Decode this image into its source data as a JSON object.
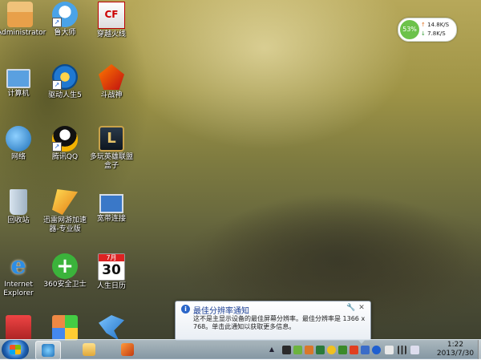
{
  "desktop": {
    "icons": [
      {
        "key": "admin",
        "label": "Administrator",
        "icon": "user-folder-icon"
      },
      {
        "key": "computer",
        "label": "计算机",
        "icon": "computer-icon"
      },
      {
        "key": "network",
        "label": "网络",
        "icon": "network-icon"
      },
      {
        "key": "recycle",
        "label": "回收站",
        "icon": "recycle-bin-icon"
      },
      {
        "key": "ie",
        "label": "Internet Explorer",
        "icon": "internet-explorer-icon"
      },
      {
        "key": "ludashi",
        "label": "鲁大师",
        "icon": "ludashi-icon"
      },
      {
        "key": "driver",
        "label": "驱动人生5",
        "icon": "driver-life-icon"
      },
      {
        "key": "qq",
        "label": "腾讯QQ",
        "icon": "qq-icon"
      },
      {
        "key": "thunder",
        "label": "迅雷网游加速器-专业版",
        "icon": "thunder-accelerator-icon"
      },
      {
        "key": "s360",
        "label": "360安全卫士",
        "icon": "360-safe-icon"
      },
      {
        "key": "cf",
        "label": "穿越火线",
        "icon": "crossfire-icon"
      },
      {
        "key": "dou",
        "label": "斗战神",
        "icon": "douzhanshen-icon"
      },
      {
        "key": "lol",
        "label": "多玩英雄联盟盒子",
        "icon": "lol-box-icon"
      },
      {
        "key": "remote",
        "label": "宽带连接",
        "icon": "broadband-connection-icon"
      },
      {
        "key": "calendar",
        "label": "人生日历",
        "icon": "life-calendar-icon",
        "month": "7月",
        "day": "30"
      }
    ]
  },
  "net_widget": {
    "percent": "53%",
    "up_arrow": "↑",
    "up_speed": "14.8K/S",
    "down_arrow": "↓",
    "down_speed": "7.8K/S"
  },
  "balloon": {
    "info_glyph": "i",
    "title": "最佳分辨率通知",
    "body": "这不是主显示设备的最佳屏幕分辨率。最佳分辨率是 1366 x 768。单击此通知以获取更多信息。",
    "options_glyph": "🔧",
    "close_glyph": "✕"
  },
  "taskbar": {
    "clock_time": "1:22",
    "clock_date": "2013/7/30",
    "tray_overflow": "▲"
  }
}
